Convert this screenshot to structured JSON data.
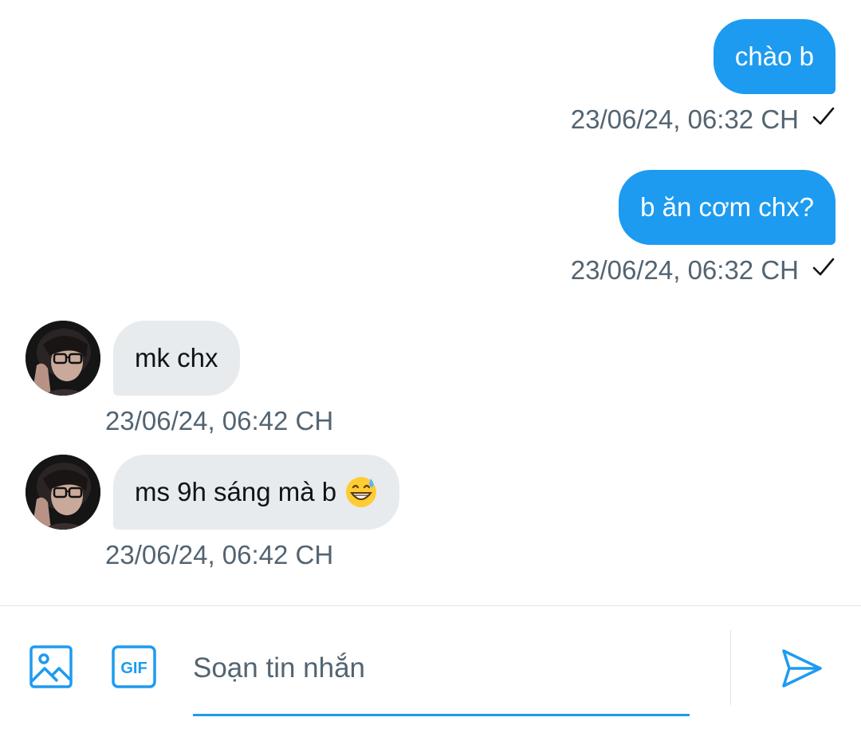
{
  "messages": [
    {
      "direction": "out",
      "text": "chào b",
      "time": "23/06/24, 06:32 CH",
      "read": "✓"
    },
    {
      "direction": "out",
      "text": "b ăn cơm chx?",
      "time": "23/06/24, 06:32 CH",
      "read": "✓"
    },
    {
      "direction": "in",
      "text": "mk chx",
      "time": "23/06/24, 06:42 CH",
      "avatar": "profile-photo"
    },
    {
      "direction": "in",
      "text": "ms 9h sáng mà b",
      "emoji": "grinning-sweat-emoji",
      "time": "23/06/24, 06:42 CH",
      "avatar": "profile-photo"
    }
  ],
  "composer": {
    "placeholder": "Soạn tin nhắn",
    "value": "",
    "image_icon": "image-icon",
    "gif_icon": "gif-icon",
    "gif_label": "GIF",
    "send_icon": "send-icon"
  },
  "colors": {
    "accent": "#1d9bf0",
    "incoming_bubble": "#e7ebee",
    "timestamp": "#536471",
    "text": "#0f1419"
  }
}
